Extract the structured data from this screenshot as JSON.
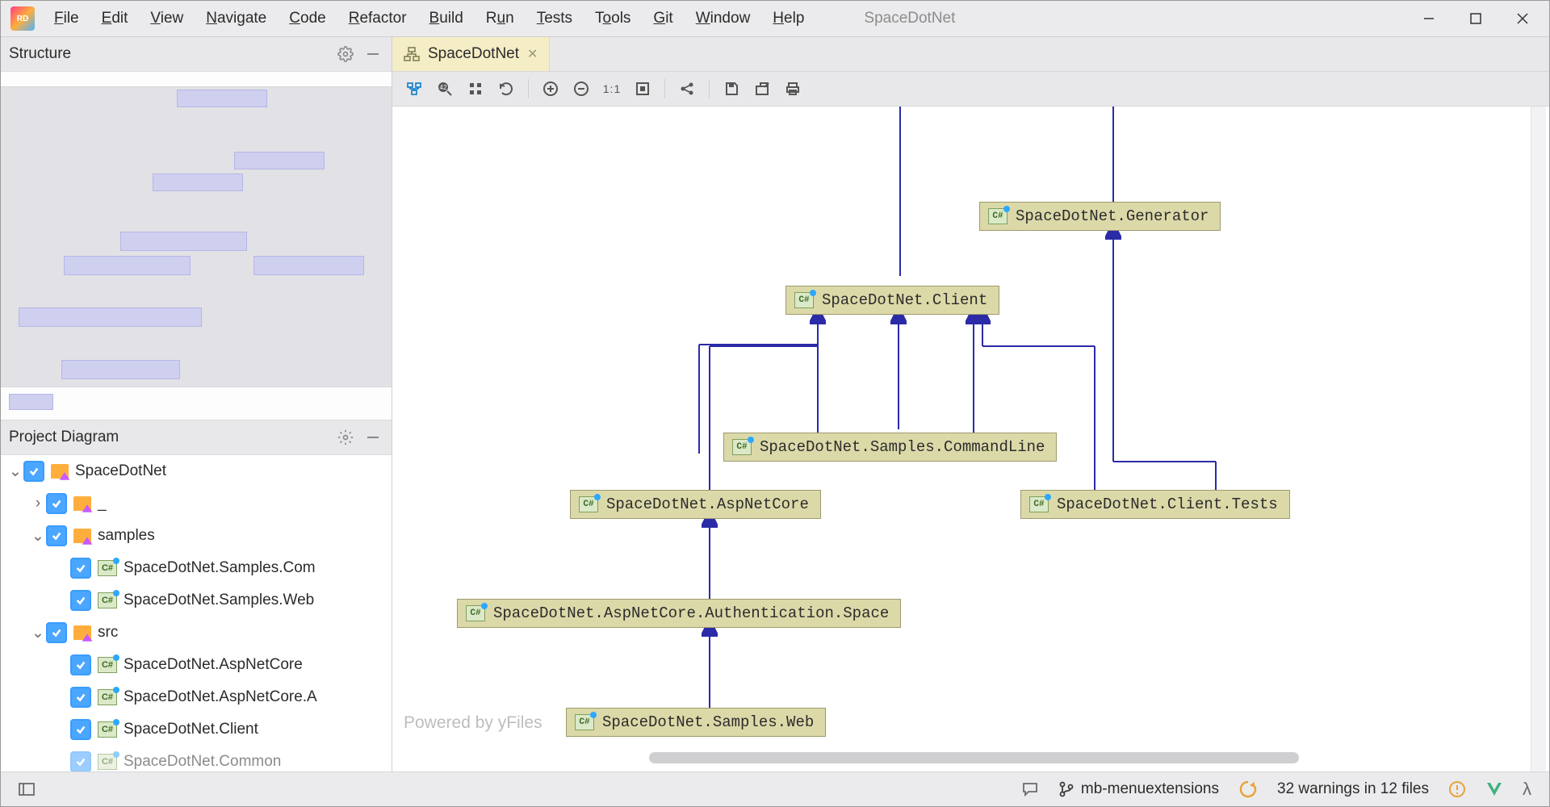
{
  "window": {
    "title": "SpaceDotNet"
  },
  "menu": {
    "file": "File",
    "edit": "Edit",
    "view": "View",
    "navigate": "Navigate",
    "code": "Code",
    "refactor": "Refactor",
    "build": "Build",
    "run": "Run",
    "tests": "Tests",
    "tools": "Tools",
    "git": "Git",
    "window": "Window",
    "help": "Help"
  },
  "structure_panel": {
    "title": "Structure"
  },
  "project_diagram_panel": {
    "title": "Project Diagram"
  },
  "tree": {
    "n0": "SpaceDotNet",
    "n1": "_",
    "n2": "samples",
    "n3": "SpaceDotNet.Samples.CommandLine",
    "n3_display": "SpaceDotNet.Samples.Com",
    "n4": "SpaceDotNet.Samples.Web",
    "n4_display": "SpaceDotNet.Samples.Web",
    "n5": "src",
    "n6": "SpaceDotNet.AspNetCore",
    "n7": "SpaceDotNet.AspNetCore.Authentication.Space",
    "n7_display": "SpaceDotNet.AspNetCore.A",
    "n8": "SpaceDotNet.Client",
    "n9": "SpaceDotNet.Common"
  },
  "tab": {
    "label": "SpaceDotNet"
  },
  "diagram": {
    "watermark": "Powered by yFiles",
    "nodes": {
      "generator": "SpaceDotNet.Generator",
      "client": "SpaceDotNet.Client",
      "cmdline": "SpaceDotNet.Samples.CommandLine",
      "aspnetcore": "SpaceDotNet.AspNetCore",
      "clienttests": "SpaceDotNet.Client.Tests",
      "auth": "SpaceDotNet.AspNetCore.Authentication.Space",
      "sampweb": "SpaceDotNet.Samples.Web"
    },
    "edges_note": "edges: Generator→(top offscreen); Client→(top offscreen); CommandLine→Client; AspNetCore→Client; Client.Tests→Client; Auth.Space→AspNetCore; Samples.Web→Auth.Space; Client.Tests→Generator"
  },
  "status": {
    "branch": "mb-menuextensions",
    "warnings": "32 warnings in 12 files"
  }
}
